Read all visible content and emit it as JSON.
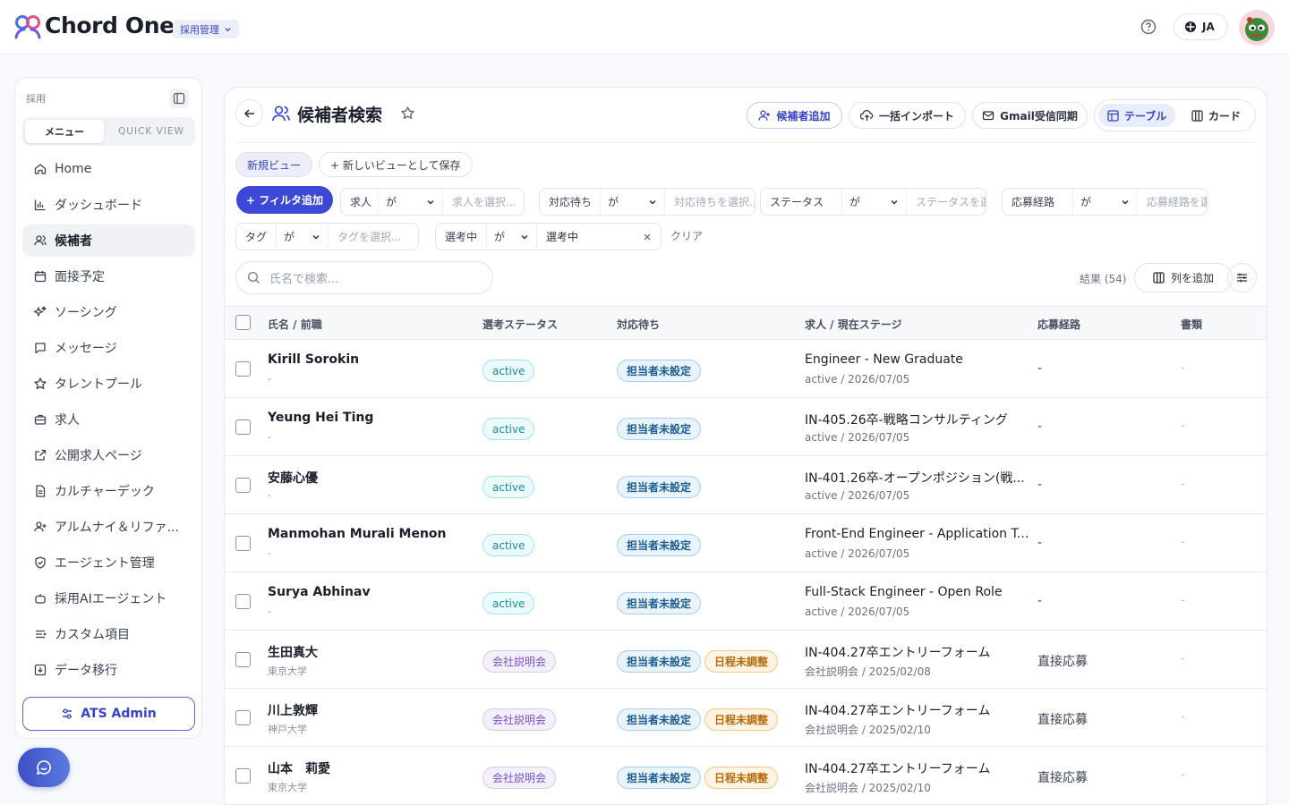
{
  "app": {
    "brand": "Chord One",
    "module": "採用管理",
    "lang": "JA"
  },
  "sidebar": {
    "title": "採用",
    "tabs": [
      "メニュー",
      "QUICK VIEW"
    ],
    "items": [
      {
        "label": "Home",
        "icon": "home-icon"
      },
      {
        "label": "ダッシュボード",
        "icon": "bar-chart-icon"
      },
      {
        "label": "候補者",
        "icon": "users-icon",
        "active": true
      },
      {
        "label": "面接予定",
        "icon": "calendar-icon"
      },
      {
        "label": "ソーシング",
        "icon": "sparkles-icon"
      },
      {
        "label": "メッセージ",
        "icon": "message-icon"
      },
      {
        "label": "タレントプール",
        "icon": "star-icon"
      },
      {
        "label": "求人",
        "icon": "briefcase-icon"
      },
      {
        "label": "公開求人ページ",
        "icon": "external-link-icon"
      },
      {
        "label": "カルチャーデック",
        "icon": "document-icon"
      },
      {
        "label": "アルムナイ＆リファ...",
        "icon": "user-plus-icon"
      },
      {
        "label": "エージェント管理",
        "icon": "shield-icon"
      },
      {
        "label": "採用AIエージェント",
        "icon": "bot-icon"
      },
      {
        "label": "カスタム項目",
        "icon": "list-icon"
      },
      {
        "label": "データ移行",
        "icon": "download-icon"
      }
    ],
    "admin_button": "ATS Admin"
  },
  "page": {
    "title": "候補者検索",
    "actions": {
      "add": "候補者追加",
      "import": "一括インポート",
      "gmail": "Gmail受信同期"
    },
    "views": {
      "table": "テーブル",
      "card": "カード"
    },
    "view_chips": {
      "new_view": "新規ビュー",
      "save_as": "+ 新しいビューとして保存"
    },
    "add_filter": "+ フィルタ追加",
    "filters": [
      {
        "field": "求人",
        "op": "が",
        "value": "求人を選択..."
      },
      {
        "field": "対応待ち",
        "op": "が",
        "value": "対応待ちを選択..."
      },
      {
        "field": "ステータス",
        "op": "が",
        "value": "ステータスを選択..."
      },
      {
        "field": "応募経路",
        "op": "が",
        "value": "応募経路を選択..."
      },
      {
        "field": "タグ",
        "op": "が",
        "value": "タグを選択..."
      },
      {
        "field": "選考中",
        "op": "が",
        "value": "選考中"
      }
    ],
    "clear": "クリア",
    "search_placeholder": "氏名で検索...",
    "results": "結果 (54)",
    "add_column": "列を追加"
  },
  "table": {
    "columns": [
      "氏名 / 前職",
      "選考ステータス",
      "対応待ち",
      "求人 / 現在ステージ",
      "応募経路",
      "書類"
    ],
    "rows": [
      {
        "name": "Kirill Sorokin",
        "sub": "-",
        "status": "active",
        "waiting": [
          "担当者未設定"
        ],
        "job": "Engineer - New Graduate",
        "stage": "active / 2026/07/05",
        "route": "-",
        "doc": "-"
      },
      {
        "name": "Yeung Hei Ting",
        "sub": "-",
        "status": "active",
        "waiting": [
          "担当者未設定"
        ],
        "job": "IN-405.26卒-戦略コンサルティング",
        "stage": "active / 2026/07/05",
        "route": "-",
        "doc": "-"
      },
      {
        "name": "安藤心優",
        "sub": "-",
        "status": "active",
        "waiting": [
          "担当者未設定"
        ],
        "job": "IN-401.26卒-オープンポジション(戦...",
        "stage": "active / 2026/07/05",
        "route": "-",
        "doc": "-"
      },
      {
        "name": "Manmohan Murali Menon",
        "sub": "-",
        "status": "active",
        "waiting": [
          "担当者未設定"
        ],
        "job": "Front-End Engineer - Application Te...",
        "stage": "active / 2026/07/05",
        "route": "-",
        "doc": "-"
      },
      {
        "name": "Surya Abhinav",
        "sub": "-",
        "status": "active",
        "waiting": [
          "担当者未設定"
        ],
        "job": "Full-Stack Engineer - Open Role",
        "stage": "active / 2026/07/05",
        "route": "-",
        "doc": "-"
      },
      {
        "name": "生田真大",
        "sub": "東京大学",
        "status": "会社説明会",
        "waiting": [
          "担当者未設定",
          "日程未調整"
        ],
        "job": "IN-404.27卒エントリーフォーム",
        "stage": "会社説明会 / 2025/02/08",
        "route": "直接応募",
        "doc": "-"
      },
      {
        "name": "川上敦輝",
        "sub": "神戸大学",
        "status": "会社説明会",
        "waiting": [
          "担当者未設定",
          "日程未調整"
        ],
        "job": "IN-404.27卒エントリーフォーム",
        "stage": "会社説明会 / 2025/02/10",
        "route": "直接応募",
        "doc": "-"
      },
      {
        "name": "山本　莉愛",
        "sub": "東京大学",
        "status": "会社説明会",
        "waiting": [
          "担当者未設定",
          "日程未調整"
        ],
        "job": "IN-404.27卒エントリーフォーム",
        "stage": "会社説明会 / 2025/02/10",
        "route": "直接応募",
        "doc": "-"
      }
    ]
  }
}
